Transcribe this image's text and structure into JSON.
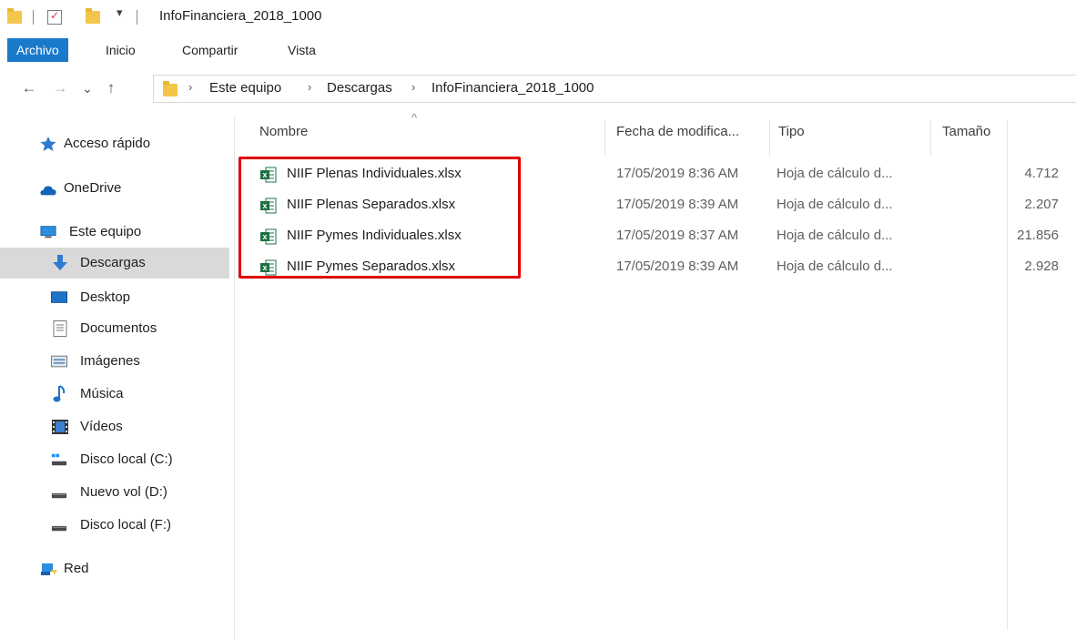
{
  "window": {
    "title": "InfoFinanciera_2018_1000"
  },
  "quick_access": {
    "dropdown_glyph": "▾"
  },
  "ribbon": {
    "tabs": [
      "Archivo",
      "Inicio",
      "Compartir",
      "Vista"
    ]
  },
  "nav_buttons": {
    "back": "←",
    "forward": "→",
    "recent": "⌄",
    "up": "↑"
  },
  "breadcrumb": {
    "separator": "›",
    "items": [
      "Este equipo",
      "Descargas",
      "InfoFinanciera_2018_1000"
    ]
  },
  "sidebar": {
    "items": [
      {
        "label": "Acceso rápido",
        "icon": "star-icon"
      },
      {
        "label": "OneDrive",
        "icon": "cloud-icon"
      },
      {
        "label": "Este equipo",
        "icon": "computer-icon"
      },
      {
        "label": "Descargas",
        "icon": "download-icon"
      },
      {
        "label": "Desktop",
        "icon": "desktop-icon"
      },
      {
        "label": "Documentos",
        "icon": "document-icon"
      },
      {
        "label": "Imágenes",
        "icon": "image-icon"
      },
      {
        "label": "Música",
        "icon": "music-icon"
      },
      {
        "label": "Vídeos",
        "icon": "video-icon"
      },
      {
        "label": "Disco local (C:)",
        "icon": "drive-c-icon"
      },
      {
        "label": "Nuevo vol (D:)",
        "icon": "drive-icon"
      },
      {
        "label": "Disco local (F:)",
        "icon": "drive-icon"
      },
      {
        "label": "Red",
        "icon": "network-icon"
      }
    ]
  },
  "columns": {
    "sort_glyph": "^",
    "name": "Nombre",
    "date": "Fecha de modifica...",
    "type": "Tipo",
    "size": "Tamaño"
  },
  "files": [
    {
      "name": "NIIF Plenas Individuales.xlsx",
      "date": "17/05/2019 8:36 AM",
      "type": "Hoja de cálculo d...",
      "size": "4.712"
    },
    {
      "name": "NIIF Plenas Separados.xlsx",
      "date": "17/05/2019 8:39 AM",
      "type": "Hoja de cálculo d...",
      "size": "2.207"
    },
    {
      "name": "NIIF Pymes Individuales.xlsx",
      "date": "17/05/2019 8:37 AM",
      "type": "Hoja de cálculo d...",
      "size": "21.856"
    },
    {
      "name": "NIIF Pymes Separados.xlsx",
      "date": "17/05/2019 8:39 AM",
      "type": "Hoja de cálculo d...",
      "size": "2.928"
    }
  ],
  "colors": {
    "accent": "#1979ca",
    "highlight": "#e00000",
    "excel": "#1d7044",
    "folder": "#f3c64b"
  }
}
